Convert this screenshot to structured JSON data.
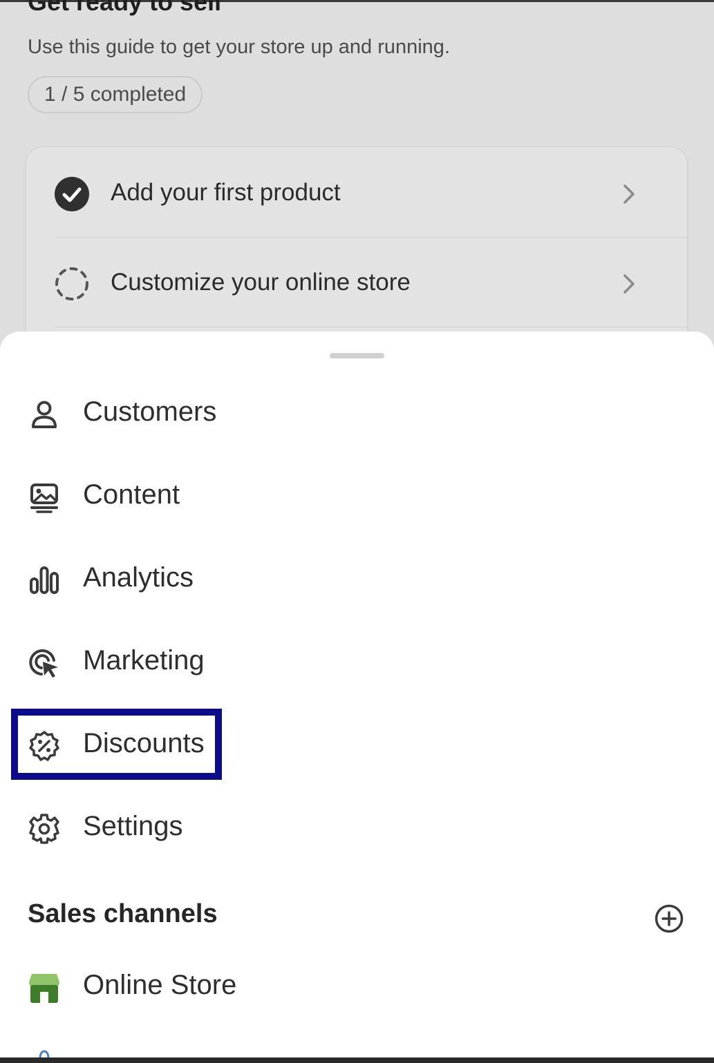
{
  "guide": {
    "title": "Get ready to sell",
    "subtitle": "Use this guide to get your store up and running.",
    "progress": "1 / 5 completed",
    "tasks": [
      {
        "label": "Add your first product",
        "status": "completed",
        "icon": "check-circle-icon"
      },
      {
        "label": "Customize your online store",
        "status": "pending",
        "icon": "dashed-circle-icon"
      }
    ]
  },
  "menu": {
    "items": [
      {
        "label": "Customers",
        "icon": "person-icon"
      },
      {
        "label": "Content",
        "icon": "image-icon"
      },
      {
        "label": "Analytics",
        "icon": "bar-chart-icon"
      },
      {
        "label": "Marketing",
        "icon": "target-cursor-icon"
      },
      {
        "label": "Discounts",
        "icon": "discount-badge-icon",
        "highlighted": true
      },
      {
        "label": "Settings",
        "icon": "gear-icon"
      }
    ]
  },
  "sales_channels": {
    "title": "Sales channels",
    "add_icon": "plus-circle-icon",
    "items": [
      {
        "label": "Online Store",
        "icon": "store-icon"
      }
    ]
  },
  "colors": {
    "highlight": "#0b0b8c",
    "store_green": "#6aa84f",
    "background_overlay": "#dedede"
  }
}
